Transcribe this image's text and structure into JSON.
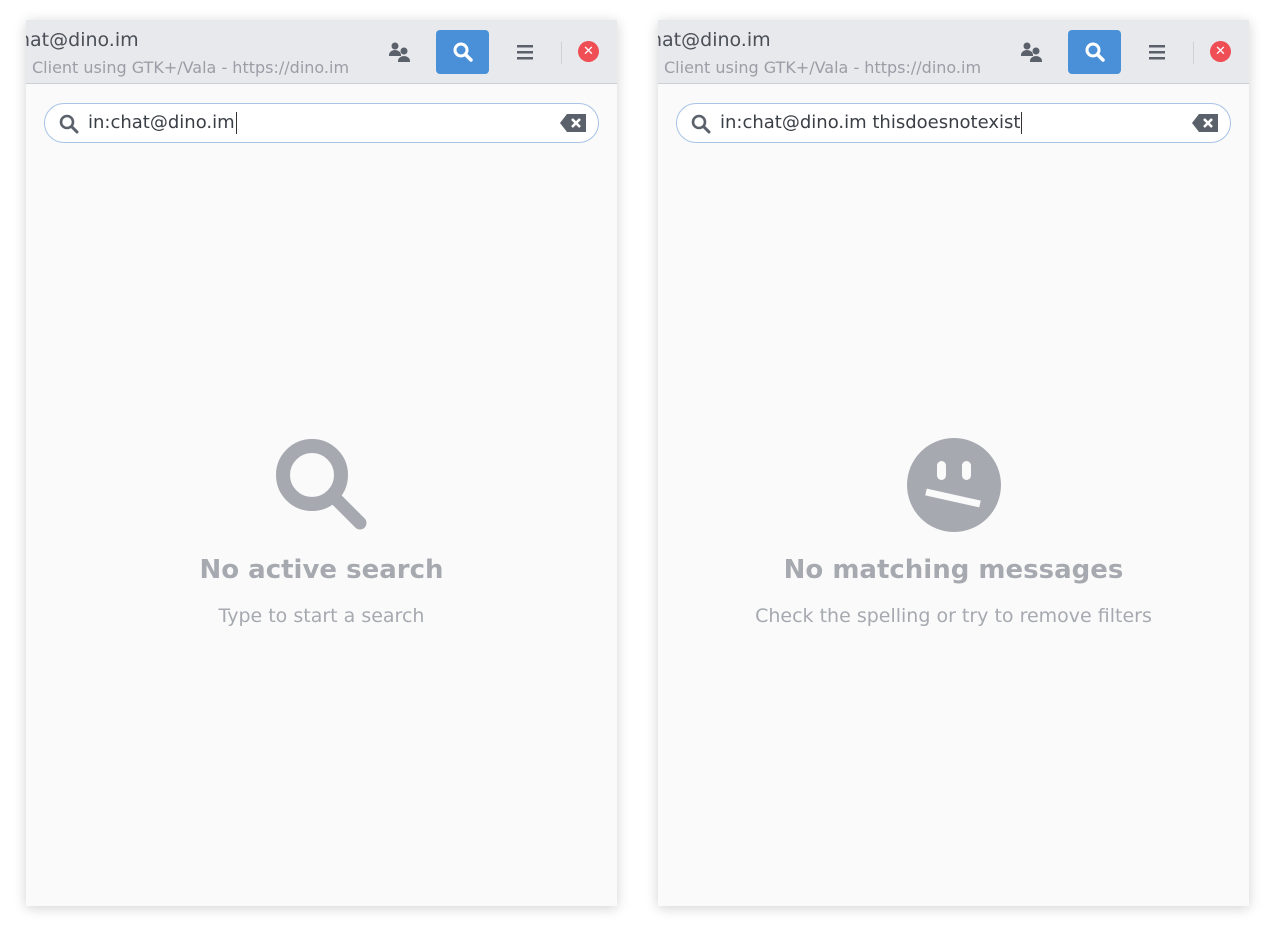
{
  "panels": [
    {
      "title": "hat@dino.im",
      "subtitle": "Client using GTK+/Vala - https://dino.im",
      "search_value": "in:chat@dino.im",
      "empty_icon": "search-icon",
      "empty_title": "No active search",
      "empty_subtitle": "Type to start a search"
    },
    {
      "title": "hat@dino.im",
      "subtitle": "Client using GTK+/Vala - https://dino.im",
      "search_value": "in:chat@dino.im thisdoesnotexist",
      "empty_icon": "confused-face-icon",
      "empty_title": "No matching messages",
      "empty_subtitle": "Check the spelling or try to remove filters"
    }
  ],
  "colors": {
    "accent": "#4a90d9",
    "close": "#ef4e55"
  }
}
